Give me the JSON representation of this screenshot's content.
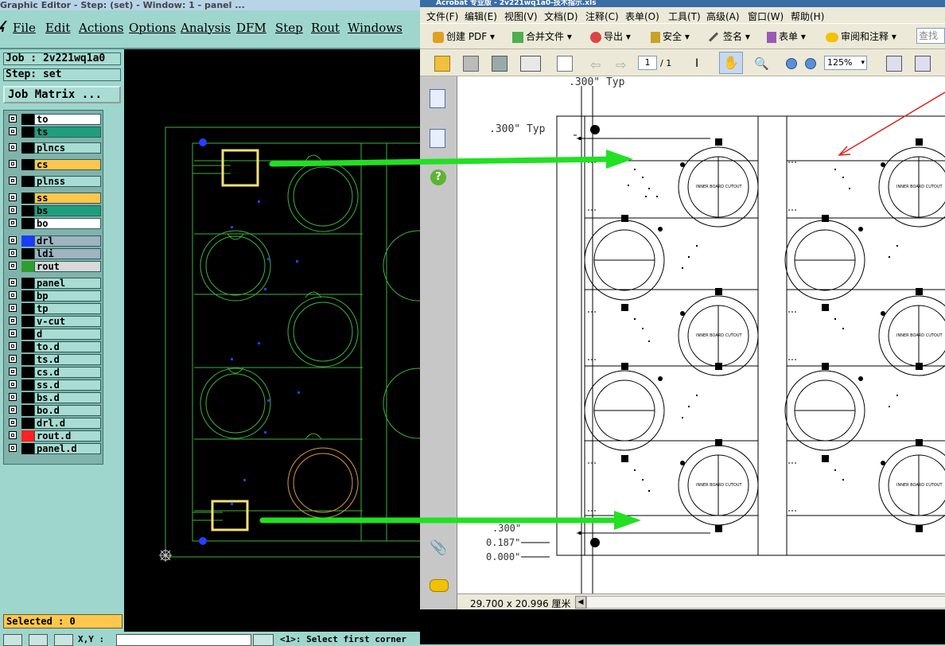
{
  "genesis": {
    "title": "Graphic Editor - Step: (set) - Window: 1 - panel ...",
    "menu": [
      "File",
      "Edit",
      "Actions",
      "Options",
      "Analysis",
      "DFM",
      "Step",
      "Rout",
      "Windows"
    ],
    "job": "Job : 2v221wq1a0",
    "step": "Step: set",
    "job_matrix": "Job Matrix ...",
    "layers": [
      {
        "name": "to",
        "bg": "#ffffff",
        "swatch": "#000000"
      },
      {
        "name": "ts",
        "bg": "#1f9e7e",
        "swatch": "#000000"
      },
      {
        "name": "plncs",
        "bg": "#a9dcd3",
        "swatch": "#000000"
      },
      {
        "name": "cs",
        "bg": "#ffc64d",
        "swatch": "#000000"
      },
      {
        "name": "plnss",
        "bg": "#a9dcd3",
        "swatch": "#000000"
      },
      {
        "name": "ss",
        "bg": "#ffc64d",
        "swatch": "#000000"
      },
      {
        "name": "bs",
        "bg": "#1f9e7e",
        "swatch": "#000000"
      },
      {
        "name": "bo",
        "bg": "#ffffff",
        "swatch": "#000000"
      },
      {
        "name": "drl",
        "bg": "#9fb3c0",
        "swatch": "#1a3cff"
      },
      {
        "name": "ldi",
        "bg": "#9fb3c0",
        "swatch": "#000000"
      },
      {
        "name": "rout",
        "bg": "#d9d9d9",
        "swatch": "#2f9e2f"
      },
      {
        "name": "panel",
        "bg": "#a9dcd3",
        "swatch": "#000000"
      },
      {
        "name": "bp",
        "bg": "#a9dcd3",
        "swatch": "#000000"
      },
      {
        "name": "tp",
        "bg": "#a9dcd3",
        "swatch": "#000000"
      },
      {
        "name": "v-cut",
        "bg": "#a9dcd3",
        "swatch": "#000000"
      },
      {
        "name": "d",
        "bg": "#a9dcd3",
        "swatch": "#000000"
      },
      {
        "name": "to.d",
        "bg": "#a9dcd3",
        "swatch": "#000000"
      },
      {
        "name": "ts.d",
        "bg": "#a9dcd3",
        "swatch": "#000000"
      },
      {
        "name": "cs.d",
        "bg": "#a9dcd3",
        "swatch": "#000000"
      },
      {
        "name": "ss.d",
        "bg": "#a9dcd3",
        "swatch": "#000000"
      },
      {
        "name": "bs.d",
        "bg": "#a9dcd3",
        "swatch": "#000000"
      },
      {
        "name": "bo.d",
        "bg": "#a9dcd3",
        "swatch": "#000000"
      },
      {
        "name": "drl.d",
        "bg": "#a9dcd3",
        "swatch": "#000000"
      },
      {
        "name": "rout.d",
        "bg": "#a9dcd3",
        "swatch": "#ff2020"
      },
      {
        "name": "panel.d",
        "bg": "#a9dcd3",
        "swatch": "#000000"
      }
    ],
    "selected": "Selected : 0",
    "status_prompt": "<1>: Select first corner",
    "xy_label": "X,Y :"
  },
  "acrobat": {
    "title": "Acrobat 专业版 - 2v221wq1a0-技术指示.xls",
    "menu": [
      "文件(F)",
      "编辑(E)",
      "视图(V)",
      "文档(D)",
      "注释(C)",
      "表单(O)",
      "工具(T)",
      "高级(A)",
      "窗口(W)",
      "帮助(H)"
    ],
    "toolbar": [
      "创建 PDF",
      "合并文件",
      "导出",
      "安全",
      "签名",
      "表单",
      "审阅和注释"
    ],
    "search_placeholder": "查找",
    "page_current": "1",
    "page_total": "/ 1",
    "zoom": "125%",
    "page_size": "29.700 x 20.996 厘米",
    "dims": {
      "typ_top": ".300\" Typ",
      "typ_left": ".300\" Typ",
      "d300": ".300\"",
      "d187": "0.187\"",
      "d000": "0.000\""
    },
    "cutout_label": "INNER BOARD CUTOUT"
  }
}
